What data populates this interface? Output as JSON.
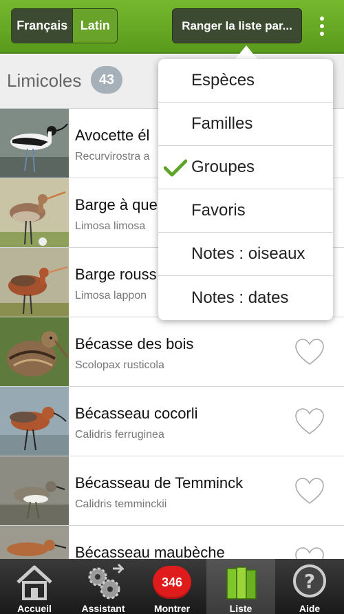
{
  "topbar": {
    "lang_fr": "Français",
    "lang_la": "Latin",
    "sort_label": "Ranger la liste par..."
  },
  "section": {
    "title": "Limicoles",
    "count": "43"
  },
  "birds": [
    {
      "name": "Avocette élégante",
      "latin": "Recurvirostra avosetta",
      "visible_name": "Avocette él",
      "visible_latin": "Recurvirostra a"
    },
    {
      "name": "Barge à queue noire",
      "latin": "Limosa limosa",
      "visible_name": "Barge à que",
      "visible_latin": "Limosa limosa"
    },
    {
      "name": "Barge rousse",
      "latin": "Limosa lapponica",
      "visible_name": "Barge rouss",
      "visible_latin": "Limosa lappon"
    },
    {
      "name": "Bécasse des bois",
      "latin": "Scolopax rusticola",
      "visible_name": "Bécasse des bois",
      "visible_latin": "Scolopax rusticola"
    },
    {
      "name": "Bécasseau cocorli",
      "latin": "Calidris ferruginea",
      "visible_name": "Bécasseau cocorli",
      "visible_latin": "Calidris ferruginea"
    },
    {
      "name": "Bécasseau de Temminck",
      "latin": "Calidris temminckii",
      "visible_name": "Bécasseau de Temminck",
      "visible_latin": "Calidris temminckii"
    },
    {
      "name": "Bécasseau maubèche",
      "latin": "",
      "visible_name": "Bécasseau maubèche",
      "visible_latin": ""
    }
  ],
  "menu": {
    "items": [
      "Espèces",
      "Familles",
      "Groupes",
      "Favoris",
      "Notes : oiseaux",
      "Notes : dates"
    ],
    "checked": "Groupes"
  },
  "bottombar": {
    "tabs": [
      "Accueil",
      "Assistant",
      "Montrer",
      "Liste",
      "Aide"
    ],
    "badge": "346",
    "active": "Liste"
  },
  "colors": {
    "topbar_green": "#6aa32a",
    "check_green": "#5fa52a",
    "badge_red": "#e01b1b"
  },
  "icons": [
    "home-icon",
    "gears-icon",
    "book-icon",
    "help-icon",
    "heart-icon",
    "check-icon",
    "kebab-menu-icon"
  ]
}
